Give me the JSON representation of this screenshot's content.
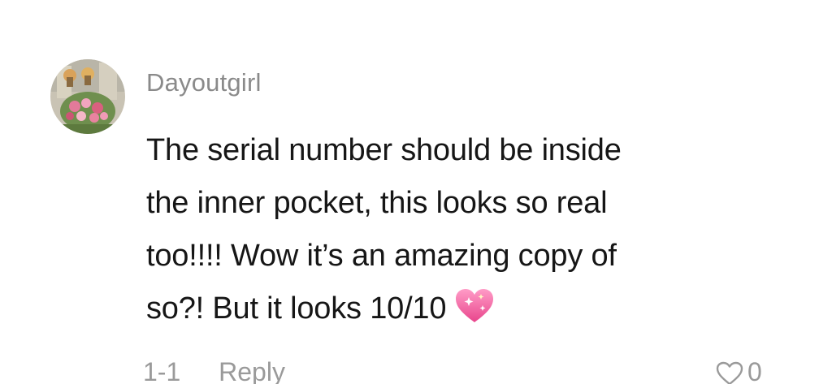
{
  "comment": {
    "username": "Dayoutgirl",
    "text_lines": [
      "The serial number should be inside",
      "the inner pocket, this looks so real",
      "too!!!! Wow it’s an amazing copy of",
      "so?! But it looks 10/10"
    ],
    "emoji": "sparkling-heart-icon",
    "date": "1-1",
    "reply_label": "Reply",
    "like_count": "0",
    "like_icon": "heart-outline-icon"
  },
  "colors": {
    "username": "#8a8a8a",
    "text": "#161616",
    "meta": "#9a9a9a",
    "heart": "#f36ba6"
  }
}
